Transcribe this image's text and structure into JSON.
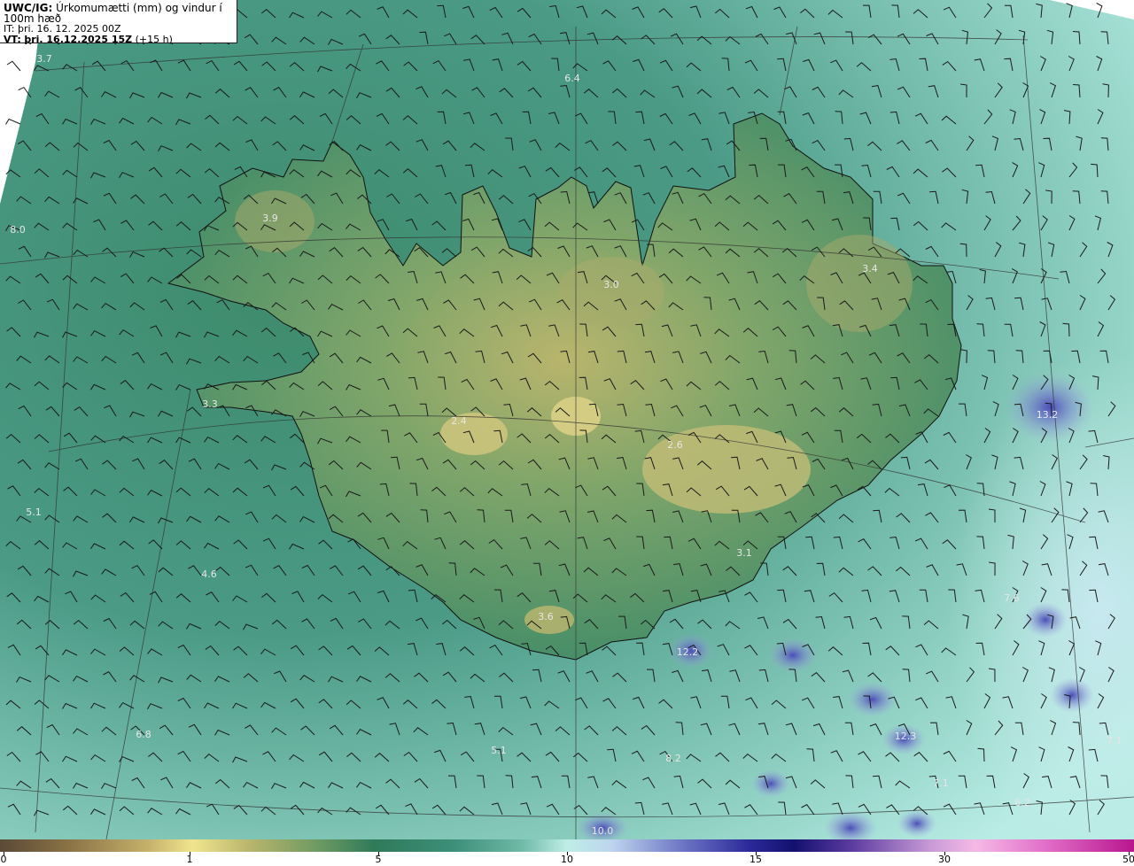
{
  "header": {
    "model_prefix": "UWC/IG:",
    "title_rest": "Úrkomumætti (mm) og vindur í 100m hæð",
    "issue_time": "IT: þri. 16. 12. 2025 00Z",
    "valid_prefix": "VT:",
    "valid_time": "þri. 16.12.2025 15Z",
    "lead": "(+15 h)"
  },
  "map": {
    "water_color": "#4e9c8a",
    "land_color": "#3f8a68",
    "coast_color": "#111111",
    "value_labels": [
      {
        "text": "3.7"
      },
      {
        "text": "6.4"
      },
      {
        "text": "8.0"
      },
      {
        "text": "3.9"
      },
      {
        "text": "3.0"
      },
      {
        "text": "3.4"
      },
      {
        "text": "3.3"
      },
      {
        "text": "2.4"
      },
      {
        "text": "2.6"
      },
      {
        "text": "13.2"
      },
      {
        "text": "5.1"
      },
      {
        "text": "4.6"
      },
      {
        "text": "3.1"
      },
      {
        "text": "7.6"
      },
      {
        "text": "3.6"
      },
      {
        "text": "12.2"
      },
      {
        "text": "6.8"
      },
      {
        "text": "8.2"
      },
      {
        "text": "5.1"
      },
      {
        "text": "12.3"
      },
      {
        "text": "7.1"
      },
      {
        "text": "7.1"
      },
      {
        "text": "6.2"
      },
      {
        "text": "10.0"
      }
    ]
  },
  "colorbar": {
    "ticks": [
      "0",
      "1",
      "5",
      "10",
      "15",
      "30",
      "50"
    ]
  }
}
